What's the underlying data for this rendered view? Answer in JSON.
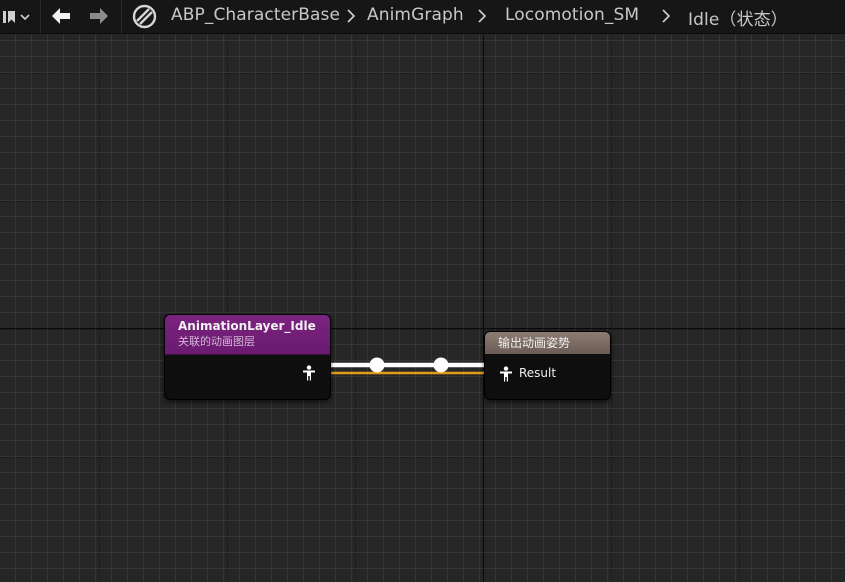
{
  "toolbar": {
    "bookmark_icon": "bookmark-icon",
    "back_icon": "arrow-left-icon",
    "forward_icon": "arrow-right-icon",
    "asset_icon": "anim-blueprint-icon"
  },
  "breadcrumb": {
    "items": [
      {
        "label": "ABP_CharacterBase"
      },
      {
        "label": "AnimGraph"
      },
      {
        "label": "Locomotion_SM"
      },
      {
        "label": "Idle（状态）"
      }
    ],
    "separator_icon": "chevron-right-icon"
  },
  "nodes": {
    "layer": {
      "title": "AnimationLayer_Idle",
      "subtitle": "关联的动画图层",
      "header_color": "#7b2380",
      "pin_icon": "pose-pin-icon"
    },
    "output": {
      "title": "输出动画姿势",
      "header_color": "#8d7c72",
      "pin_label": "Result",
      "pin_icon": "pose-pin-icon"
    }
  },
  "wire": {
    "color": "#ffffff",
    "exec_color": "#e39b1c",
    "reroute_icon": "reroute-node-icon"
  }
}
